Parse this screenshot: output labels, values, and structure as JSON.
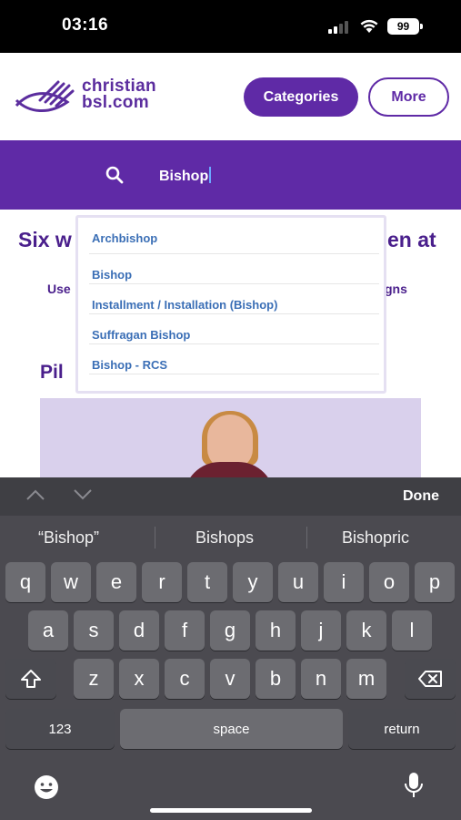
{
  "status_bar": {
    "time": "03:16",
    "battery": "99"
  },
  "header": {
    "logo_line1": "christian",
    "logo_line2": "bsl.com",
    "categories_label": "Categories",
    "more_label": "More"
  },
  "search": {
    "value": "Bishop"
  },
  "page": {
    "title_left": "Six w",
    "title_right": "en at",
    "sub_left": "Use",
    "sub_right": "gns",
    "heading": "Pil"
  },
  "suggestions": [
    {
      "label": "Archbishop"
    },
    {
      "label": "Bishop"
    },
    {
      "label": "Installment / Installation (Bishop)"
    },
    {
      "label": "Suffragan Bishop"
    },
    {
      "label": "Bishop - RCS"
    }
  ],
  "keyboard": {
    "done_label": "Done",
    "predictions": [
      "“Bishop”",
      "Bishops",
      "Bishopric"
    ],
    "row1": [
      "q",
      "w",
      "e",
      "r",
      "t",
      "y",
      "u",
      "i",
      "o",
      "p"
    ],
    "row2": [
      "a",
      "s",
      "d",
      "f",
      "g",
      "h",
      "j",
      "k",
      "l"
    ],
    "row3": [
      "z",
      "x",
      "c",
      "v",
      "b",
      "n",
      "m"
    ],
    "numbers_label": "123",
    "space_label": "space",
    "return_label": "return"
  },
  "colors": {
    "brand_purple": "#5f2aa6",
    "link_blue": "#3b6fb6"
  }
}
